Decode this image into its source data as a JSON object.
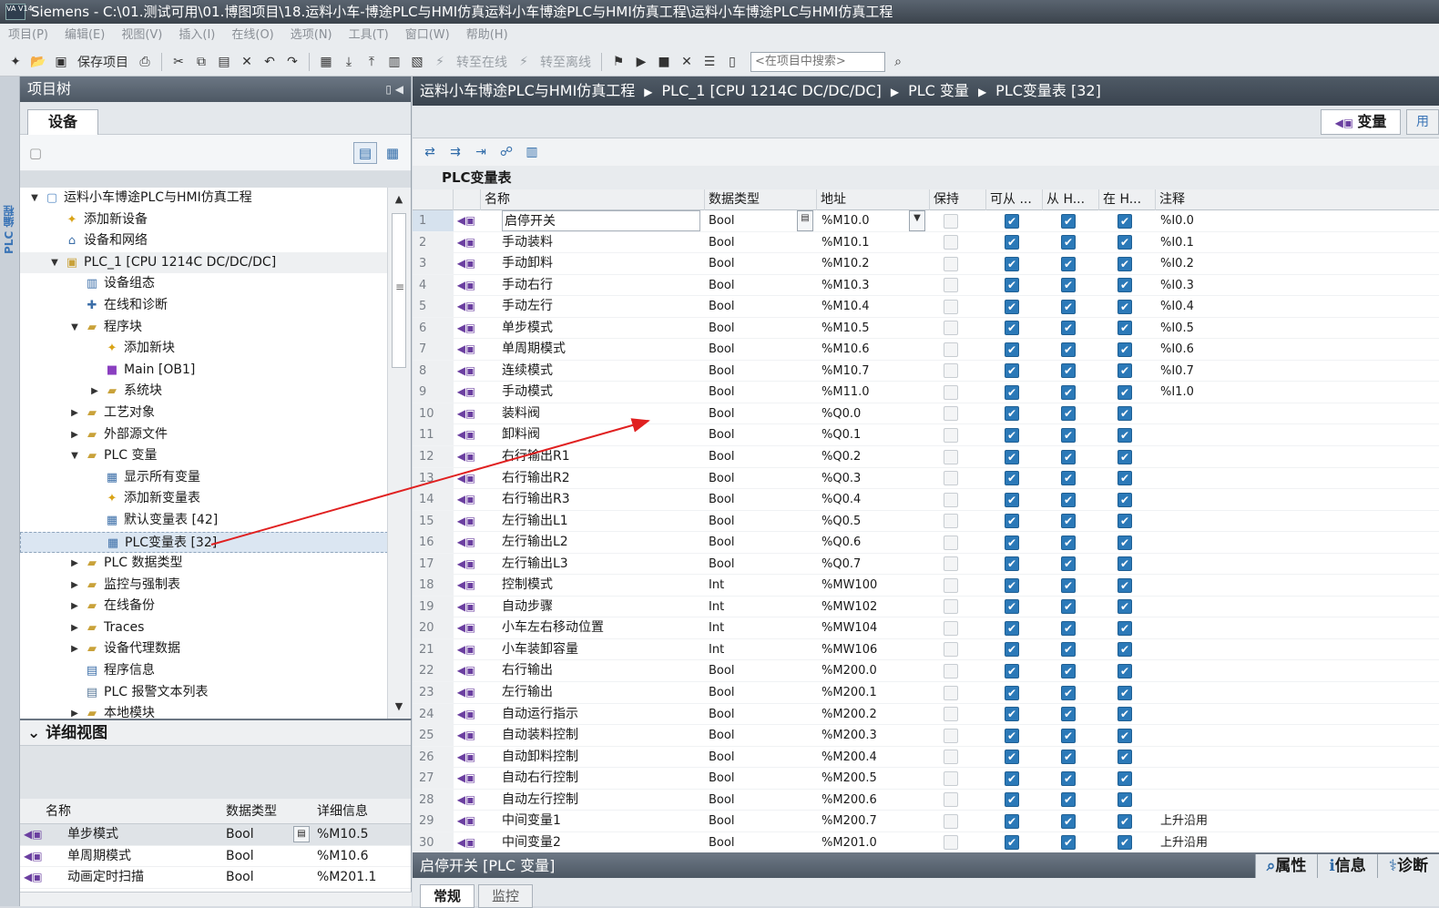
{
  "app": {
    "title": "Siemens  -  C:\\01.测试可用\\01.博图项目\\18.运料小车-博途PLC与HMI仿真运料小车博途PLC与HMI仿真工程\\运料小车博途PLC与HMI仿真工程",
    "logo_text": "VA V14"
  },
  "menu": [
    "项目(P)",
    "编辑(E)",
    "视图(V)",
    "插入(I)",
    "在线(O)",
    "选项(N)",
    "工具(T)",
    "窗口(W)",
    "帮助(H)"
  ],
  "toolbar": {
    "save_label": "保存项目",
    "go_online_label": "转至在线",
    "go_offline_label": "转至离线",
    "search_placeholder": "<在项目中搜索>"
  },
  "left_strip_label": "PLC 编程",
  "project_tree": {
    "title": "项目树",
    "devices_tab": "设备",
    "items": [
      {
        "label": "运料小车博途PLC与HMI仿真工程",
        "level": 0,
        "expand": "open",
        "icon": "project-icon"
      },
      {
        "label": "添加新设备",
        "level": 1,
        "expand": "",
        "icon": "add-device-icon"
      },
      {
        "label": "设备和网络",
        "level": 1,
        "expand": "",
        "icon": "network-icon"
      },
      {
        "label": "PLC_1 [CPU 1214C DC/DC/DC]",
        "level": 1,
        "expand": "open",
        "icon": "plc-icon"
      },
      {
        "label": "设备组态",
        "level": 2,
        "expand": "",
        "icon": "device-config-icon"
      },
      {
        "label": "在线和诊断",
        "level": 2,
        "expand": "",
        "icon": "diagnostics-icon"
      },
      {
        "label": "程序块",
        "level": 2,
        "expand": "open",
        "icon": "folder-icon"
      },
      {
        "label": "添加新块",
        "level": 3,
        "expand": "",
        "icon": "add-block-icon"
      },
      {
        "label": "Main [OB1]",
        "level": 3,
        "expand": "",
        "icon": "ob-icon"
      },
      {
        "label": "系统块",
        "level": 3,
        "expand": "closed",
        "icon": "folder-icon"
      },
      {
        "label": "工艺对象",
        "level": 2,
        "expand": "closed",
        "icon": "folder-icon"
      },
      {
        "label": "外部源文件",
        "level": 2,
        "expand": "closed",
        "icon": "folder-icon"
      },
      {
        "label": "PLC 变量",
        "level": 2,
        "expand": "open",
        "icon": "folder-icon"
      },
      {
        "label": "显示所有变量",
        "level": 3,
        "expand": "",
        "icon": "tag-table-icon"
      },
      {
        "label": "添加新变量表",
        "level": 3,
        "expand": "",
        "icon": "add-tag-table-icon"
      },
      {
        "label": "默认变量表 [42]",
        "level": 3,
        "expand": "",
        "icon": "tag-table-icon"
      },
      {
        "label": "PLC变量表 [32]",
        "level": 3,
        "expand": "",
        "icon": "tag-table-icon",
        "selected": true
      },
      {
        "label": "PLC 数据类型",
        "level": 2,
        "expand": "closed",
        "icon": "folder-icon"
      },
      {
        "label": "监控与强制表",
        "level": 2,
        "expand": "closed",
        "icon": "folder-icon"
      },
      {
        "label": "在线备份",
        "level": 2,
        "expand": "closed",
        "icon": "folder-icon"
      },
      {
        "label": "Traces",
        "level": 2,
        "expand": "closed",
        "icon": "folder-icon"
      },
      {
        "label": "设备代理数据",
        "level": 2,
        "expand": "closed",
        "icon": "folder-icon"
      },
      {
        "label": "程序信息",
        "level": 2,
        "expand": "",
        "icon": "program-info-icon"
      },
      {
        "label": "PLC 报警文本列表",
        "level": 2,
        "expand": "",
        "icon": "alarm-text-icon"
      },
      {
        "label": "本地模块",
        "level": 2,
        "expand": "closed",
        "icon": "folder-icon"
      }
    ]
  },
  "detail_view": {
    "title": "详细视图",
    "columns": [
      "名称",
      "数据类型",
      "详细信息"
    ],
    "rows": [
      {
        "name": "单步模式",
        "type": "Bool",
        "detail": "%M10.5"
      },
      {
        "name": "单周期模式",
        "type": "Bool",
        "detail": "%M10.6"
      },
      {
        "name": "动画定时扫描",
        "type": "Bool",
        "detail": "%M201.1"
      }
    ]
  },
  "breadcrumb": [
    "运料小车博途PLC与HMI仿真工程",
    "PLC_1 [CPU 1214C DC/DC/DC]",
    "PLC 变量",
    "PLC变量表 [32]"
  ],
  "editor_tabs": {
    "tags": "变量",
    "user_constants": "用"
  },
  "tag_table": {
    "title": "PLC变量表",
    "columns": [
      "名称",
      "数据类型",
      "地址",
      "保持",
      "可从 ...",
      "从 H...",
      "在 H...",
      "注释"
    ],
    "rows": [
      {
        "n": "1",
        "name": "启停开关",
        "type": "Bool",
        "addr": "%M10.0",
        "retain": false,
        "acc": true,
        "hmi_w": true,
        "hmi_v": true,
        "comment": "%I0.0"
      },
      {
        "n": "2",
        "name": "手动装料",
        "type": "Bool",
        "addr": "%M10.1",
        "retain": false,
        "acc": true,
        "hmi_w": true,
        "hmi_v": true,
        "comment": "%I0.1"
      },
      {
        "n": "3",
        "name": "手动卸料",
        "type": "Bool",
        "addr": "%M10.2",
        "retain": false,
        "acc": true,
        "hmi_w": true,
        "hmi_v": true,
        "comment": "%I0.2"
      },
      {
        "n": "4",
        "name": "手动右行",
        "type": "Bool",
        "addr": "%M10.3",
        "retain": false,
        "acc": true,
        "hmi_w": true,
        "hmi_v": true,
        "comment": "%I0.3"
      },
      {
        "n": "5",
        "name": "手动左行",
        "type": "Bool",
        "addr": "%M10.4",
        "retain": false,
        "acc": true,
        "hmi_w": true,
        "hmi_v": true,
        "comment": "%I0.4"
      },
      {
        "n": "6",
        "name": "单步模式",
        "type": "Bool",
        "addr": "%M10.5",
        "retain": false,
        "acc": true,
        "hmi_w": true,
        "hmi_v": true,
        "comment": "%I0.5"
      },
      {
        "n": "7",
        "name": "单周期模式",
        "type": "Bool",
        "addr": "%M10.6",
        "retain": false,
        "acc": true,
        "hmi_w": true,
        "hmi_v": true,
        "comment": "%I0.6"
      },
      {
        "n": "8",
        "name": "连续模式",
        "type": "Bool",
        "addr": "%M10.7",
        "retain": false,
        "acc": true,
        "hmi_w": true,
        "hmi_v": true,
        "comment": "%I0.7"
      },
      {
        "n": "9",
        "name": "手动模式",
        "type": "Bool",
        "addr": "%M11.0",
        "retain": false,
        "acc": true,
        "hmi_w": true,
        "hmi_v": true,
        "comment": "%I1.0"
      },
      {
        "n": "10",
        "name": "装料阀",
        "type": "Bool",
        "addr": "%Q0.0",
        "retain": false,
        "acc": true,
        "hmi_w": true,
        "hmi_v": true,
        "comment": ""
      },
      {
        "n": "11",
        "name": "卸料阀",
        "type": "Bool",
        "addr": "%Q0.1",
        "retain": false,
        "acc": true,
        "hmi_w": true,
        "hmi_v": true,
        "comment": ""
      },
      {
        "n": "12",
        "name": "右行输出R1",
        "type": "Bool",
        "addr": "%Q0.2",
        "retain": false,
        "acc": true,
        "hmi_w": true,
        "hmi_v": true,
        "comment": ""
      },
      {
        "n": "13",
        "name": "右行输出R2",
        "type": "Bool",
        "addr": "%Q0.3",
        "retain": false,
        "acc": true,
        "hmi_w": true,
        "hmi_v": true,
        "comment": ""
      },
      {
        "n": "14",
        "name": "右行输出R3",
        "type": "Bool",
        "addr": "%Q0.4",
        "retain": false,
        "acc": true,
        "hmi_w": true,
        "hmi_v": true,
        "comment": ""
      },
      {
        "n": "15",
        "name": "左行输出L1",
        "type": "Bool",
        "addr": "%Q0.5",
        "retain": false,
        "acc": true,
        "hmi_w": true,
        "hmi_v": true,
        "comment": ""
      },
      {
        "n": "16",
        "name": "左行输出L2",
        "type": "Bool",
        "addr": "%Q0.6",
        "retain": false,
        "acc": true,
        "hmi_w": true,
        "hmi_v": true,
        "comment": ""
      },
      {
        "n": "17",
        "name": "左行输出L3",
        "type": "Bool",
        "addr": "%Q0.7",
        "retain": false,
        "acc": true,
        "hmi_w": true,
        "hmi_v": true,
        "comment": ""
      },
      {
        "n": "18",
        "name": "控制模式",
        "type": "Int",
        "addr": "%MW100",
        "retain": false,
        "acc": true,
        "hmi_w": true,
        "hmi_v": true,
        "comment": ""
      },
      {
        "n": "19",
        "name": "自动步骤",
        "type": "Int",
        "addr": "%MW102",
        "retain": false,
        "acc": true,
        "hmi_w": true,
        "hmi_v": true,
        "comment": ""
      },
      {
        "n": "20",
        "name": "小车左右移动位置",
        "type": "Int",
        "addr": "%MW104",
        "retain": false,
        "acc": true,
        "hmi_w": true,
        "hmi_v": true,
        "comment": ""
      },
      {
        "n": "21",
        "name": "小车装卸容量",
        "type": "Int",
        "addr": "%MW106",
        "retain": false,
        "acc": true,
        "hmi_w": true,
        "hmi_v": true,
        "comment": ""
      },
      {
        "n": "22",
        "name": "右行输出",
        "type": "Bool",
        "addr": "%M200.0",
        "retain": false,
        "acc": true,
        "hmi_w": true,
        "hmi_v": true,
        "comment": ""
      },
      {
        "n": "23",
        "name": "左行输出",
        "type": "Bool",
        "addr": "%M200.1",
        "retain": false,
        "acc": true,
        "hmi_w": true,
        "hmi_v": true,
        "comment": ""
      },
      {
        "n": "24",
        "name": "自动运行指示",
        "type": "Bool",
        "addr": "%M200.2",
        "retain": false,
        "acc": true,
        "hmi_w": true,
        "hmi_v": true,
        "comment": ""
      },
      {
        "n": "25",
        "name": "自动装料控制",
        "type": "Bool",
        "addr": "%M200.3",
        "retain": false,
        "acc": true,
        "hmi_w": true,
        "hmi_v": true,
        "comment": ""
      },
      {
        "n": "26",
        "name": "自动卸料控制",
        "type": "Bool",
        "addr": "%M200.4",
        "retain": false,
        "acc": true,
        "hmi_w": true,
        "hmi_v": true,
        "comment": ""
      },
      {
        "n": "27",
        "name": "自动右行控制",
        "type": "Bool",
        "addr": "%M200.5",
        "retain": false,
        "acc": true,
        "hmi_w": true,
        "hmi_v": true,
        "comment": ""
      },
      {
        "n": "28",
        "name": "自动左行控制",
        "type": "Bool",
        "addr": "%M200.6",
        "retain": false,
        "acc": true,
        "hmi_w": true,
        "hmi_v": true,
        "comment": ""
      },
      {
        "n": "29",
        "name": "中间变量1",
        "type": "Bool",
        "addr": "%M200.7",
        "retain": false,
        "acc": true,
        "hmi_w": true,
        "hmi_v": true,
        "comment": "上升沿用"
      },
      {
        "n": "30",
        "name": "中间变量2",
        "type": "Bool",
        "addr": "%M201.0",
        "retain": false,
        "acc": true,
        "hmi_w": true,
        "hmi_v": true,
        "comment": "上升沿用"
      }
    ]
  },
  "inspector": {
    "title": "启停开关 [PLC 变量]",
    "tabs": [
      "属性",
      "信息",
      "诊断"
    ],
    "subtabs": [
      "常规",
      "监控"
    ]
  },
  "colors": {
    "accent": "#2b79b8",
    "arrow": "#e02020",
    "header_dark": "#4d5864"
  }
}
